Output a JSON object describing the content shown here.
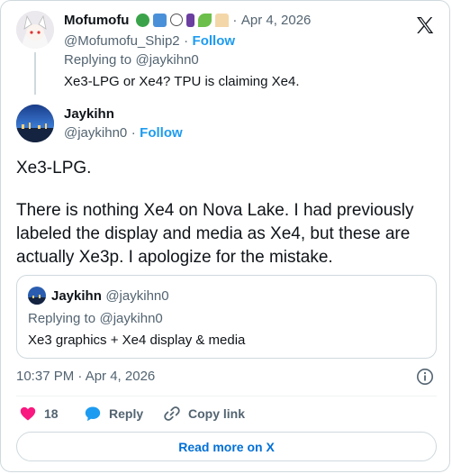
{
  "parent_tweet": {
    "display_name": "Mofumofu",
    "name_emoji": [
      "snake-emoji",
      "robot-emoji",
      "web-emoji",
      "book-emoji",
      "leaf-emoji",
      "cake-emoji"
    ],
    "separator": "·",
    "date": "Apr 4, 2026",
    "handle": "@Mofumofu_Ship2",
    "dot": "·",
    "follow_label": "Follow",
    "replying_prefix": "Replying to",
    "replying_to": "@jaykihn0",
    "text": "Xe3-LPG or Xe4? TPU is claiming Xe4."
  },
  "main_tweet": {
    "display_name": "Jaykihn",
    "handle": "@jaykihn0",
    "dot": "·",
    "follow_label": "Follow",
    "text_line1": "Xe3-LPG.",
    "text_para2": "There is nothing Xe4 on Nova Lake. I had previously labeled the display and media as Xe4, but these are actually Xe3p. I apologize for the mistake.",
    "quote": {
      "display_name": "Jaykihn",
      "handle": "@jaykihn0",
      "replying_prefix": "Replying to",
      "replying_to": "@jaykihn0",
      "text": "Xe3 graphics + Xe4 display & media"
    },
    "timestamp": "10:37 PM · Apr 4, 2026"
  },
  "actions": {
    "like_count": "18",
    "reply_label": "Reply",
    "copy_link_label": "Copy link"
  },
  "read_more_label": "Read more on X",
  "colors": {
    "link": "#1d9bf0",
    "muted": "#536471",
    "like": "#f91880",
    "border": "#cfd9de"
  }
}
